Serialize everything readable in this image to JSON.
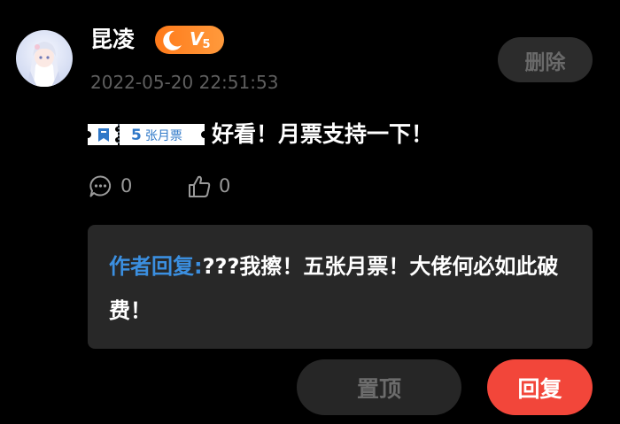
{
  "comment": {
    "username": "昆凌",
    "vip_level": "5",
    "timestamp": "2022-05-20 22:51:53",
    "monthly_ticket_count": "5",
    "monthly_ticket_unit": "张月票",
    "text": "好看！月票支持一下！",
    "reply_count": "0",
    "like_count": "0"
  },
  "author_reply": {
    "label": "作者回复:",
    "text": "???我擦！五张月票！大佬何必如此破费！"
  },
  "actions": {
    "delete_label": "删除",
    "pin_label": "置顶",
    "reply_label": "回复"
  },
  "icons": {
    "vip": "crescent-moon-v-icon",
    "ticket": "monthly-ticket-icon",
    "reply": "comment-bubble-icon",
    "like": "thumbs-up-icon"
  },
  "colors": {
    "background": "#000000",
    "reply_box": "#282828",
    "accent_blue": "#3b8fe0",
    "reply_button": "#f2463a",
    "vip_orange": "#ff8a2a",
    "muted_text": "#5f5f5f"
  }
}
